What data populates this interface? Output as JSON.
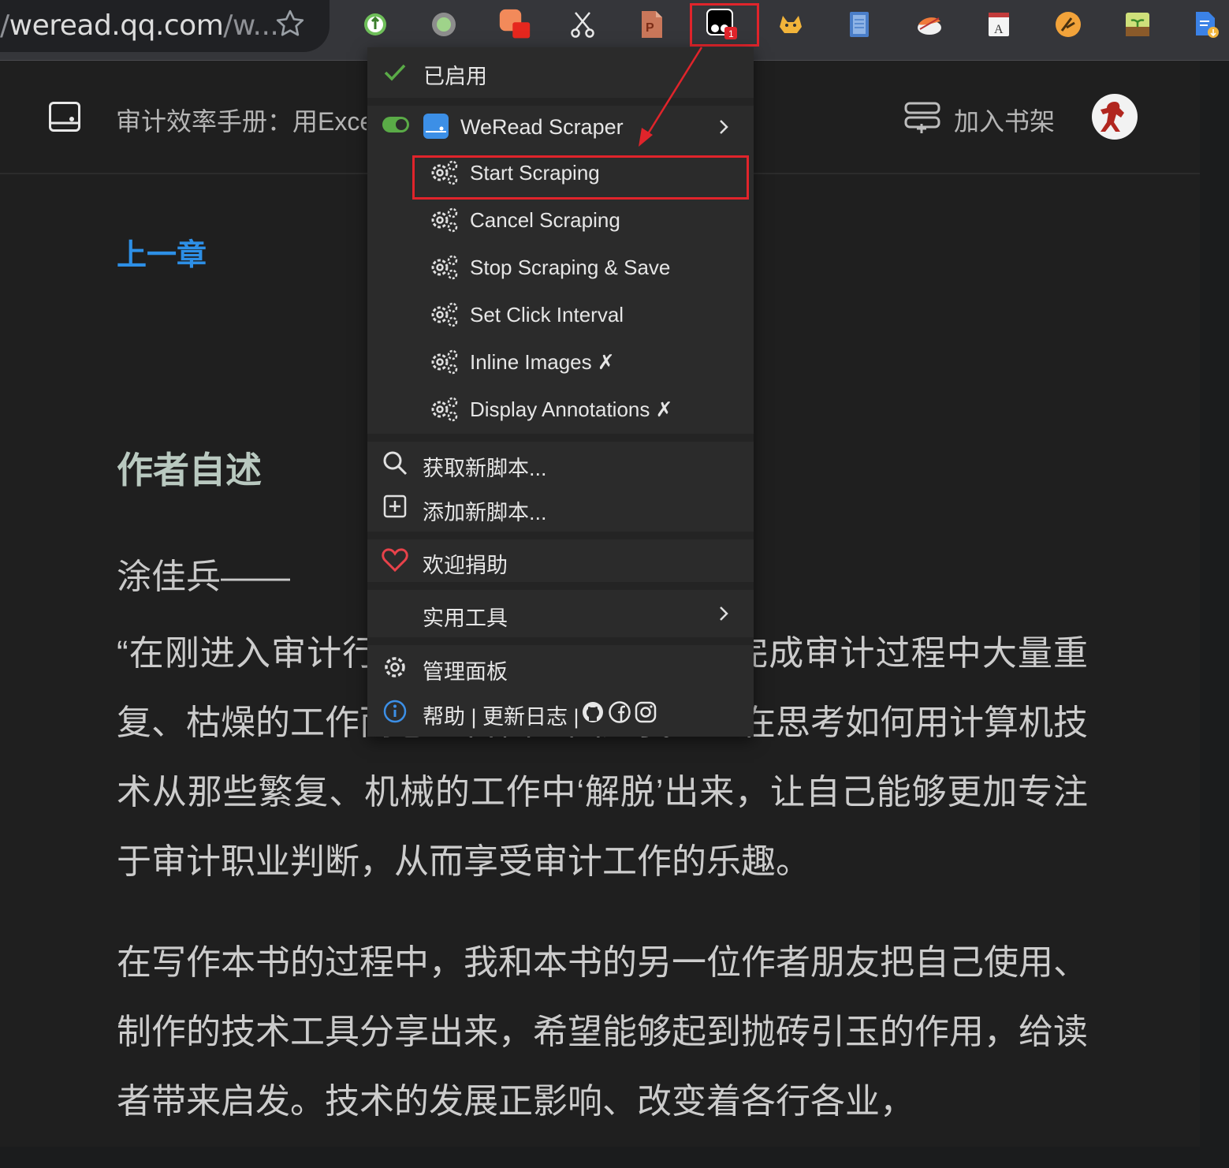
{
  "browser": {
    "url_host": "weread.qq.com",
    "url_rest": "/w...",
    "url_prefix": "/",
    "star_icon": "bookmark-star-icon",
    "extension_badge": "1",
    "extension_icons": [
      "keepass-icon",
      "circle-icon",
      "screenshot-icon",
      "scissors-icon",
      "powerpoint-icon",
      "tampermonkey-icon",
      "cat-icon",
      "notebook-icon",
      "sushi-icon",
      "dictionary-icon",
      "speed-icon",
      "plant-icon",
      "doc-download-icon"
    ]
  },
  "reader": {
    "book_title": "审计效率手册：用Excel",
    "shelf_label": "加入书架",
    "prev_chapter": "上一章",
    "chapter_heading": "作者自述",
    "author_line": "涂佳兵——",
    "paragraphs": [
      "“在刚进入审计行业的时候，我常常因为完成审计过程中大量重复、枯燥的工作而感到苦恼。因此我一直在思考如何用计算机技术从那些繁复、机械的工作中‘解脱’出来，让自己能够更加专注于审计职业判断，从而享受审计工作的乐趣。",
      "在写作本书的过程中，我和本书的另一位作者朋友把自己使用、制作的技术工具分享出来，希望能够起到抛砖引玉的作用，给读者带来启发。技术的发展正影响、改变着各行各业，"
    ]
  },
  "menu": {
    "enabled_label": "已启用",
    "script_name": "WeRead Scraper",
    "commands": [
      "Start Scraping",
      "Cancel Scraping",
      "Stop Scraping & Save",
      "Set Click Interval",
      "Inline Images ✗",
      "Display Annotations ✗"
    ],
    "get_scripts": "获取新脚本...",
    "add_script": "添加新脚本...",
    "donate": "欢迎捐助",
    "utilities": "实用工具",
    "dashboard": "管理面板",
    "help_line": "帮助 | 更新日志 |"
  },
  "colors": {
    "accent_blue": "#2d8fe6",
    "highlight_red": "#e0242b",
    "enabled_green": "#5aab47",
    "menu_bg": "#2b2b2b"
  }
}
